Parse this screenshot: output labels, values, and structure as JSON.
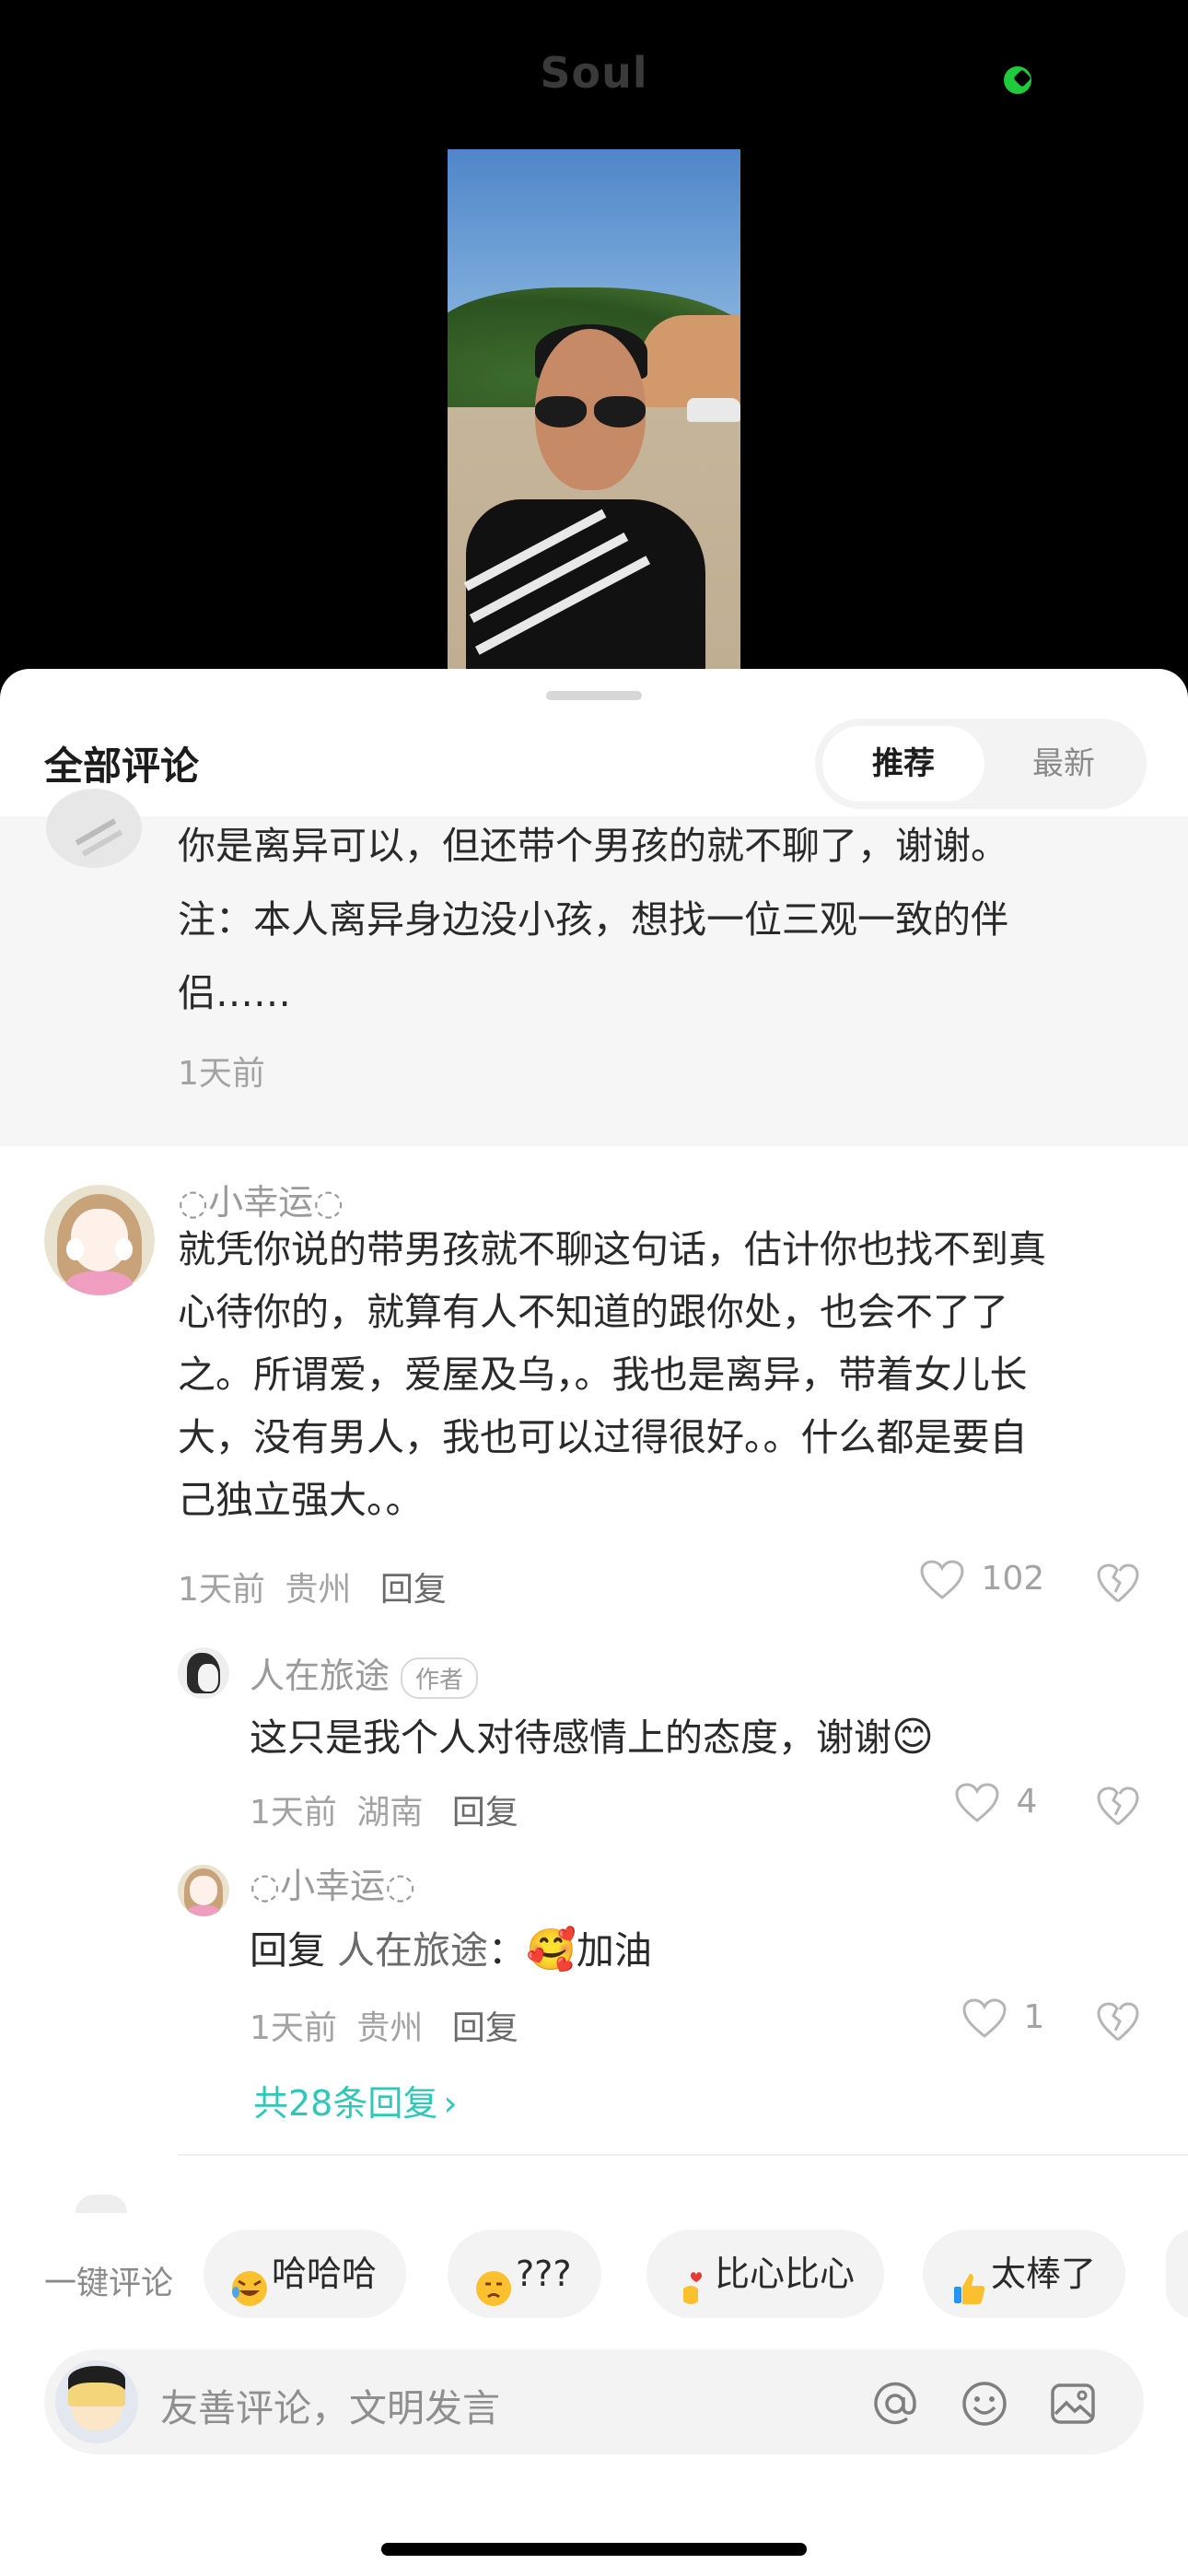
{
  "header": {
    "app_logo_text": "Soul",
    "status_color": "#1fca3b"
  },
  "sheet": {
    "title": "全部评论",
    "sort_tabs": [
      "推荐",
      "最新"
    ],
    "active_sort": "推荐"
  },
  "prev_comment": {
    "lines": [
      "你是离异可以，但还带个男孩的就不聊了，谢谢。",
      "注：本人离异身边没小孩，想找一位三观一致的伴",
      "侣……"
    ],
    "time": "1天前"
  },
  "comment": {
    "nickname": "◌小幸运◌",
    "lines": [
      "就凭你说的带男孩就不聊这句话，估计你也找不到真",
      "心待你的，就算有人不知道的跟你处，也会不了了",
      "之。所谓爱，爱屋及乌，。我也是离异，带着女儿长",
      "大，没有男人，我也可以过得很好。。什么都是要自",
      "己独立强大。。"
    ],
    "time": "1天前",
    "location": "贵州",
    "reply_label": "回复",
    "likes": "102"
  },
  "replies": [
    {
      "nickname": "人在旅途",
      "tag": "作者",
      "text": "这只是我个人对待感情上的态度，谢谢",
      "emoji": "😊",
      "time": "1天前",
      "location": "湖南",
      "reply_label": "回复",
      "likes": "4"
    },
    {
      "nickname": "◌小幸运◌",
      "text_prefix": "回复",
      "reply_to": "人在旅途",
      "colon": "：",
      "emoji": "🥰",
      "text_suffix": "加油",
      "time": "1天前",
      "location": "贵州",
      "reply_label": "回复",
      "likes": "1"
    }
  ],
  "more_replies": "共28条回复",
  "quick_comment": {
    "label": "一键评论",
    "chips": [
      "哈哈哈",
      "???",
      "比心比心",
      "太棒了"
    ]
  },
  "input": {
    "placeholder": "友善评论，文明发言",
    "icons": [
      "at-icon",
      "emoji-icon",
      "image-icon"
    ]
  }
}
